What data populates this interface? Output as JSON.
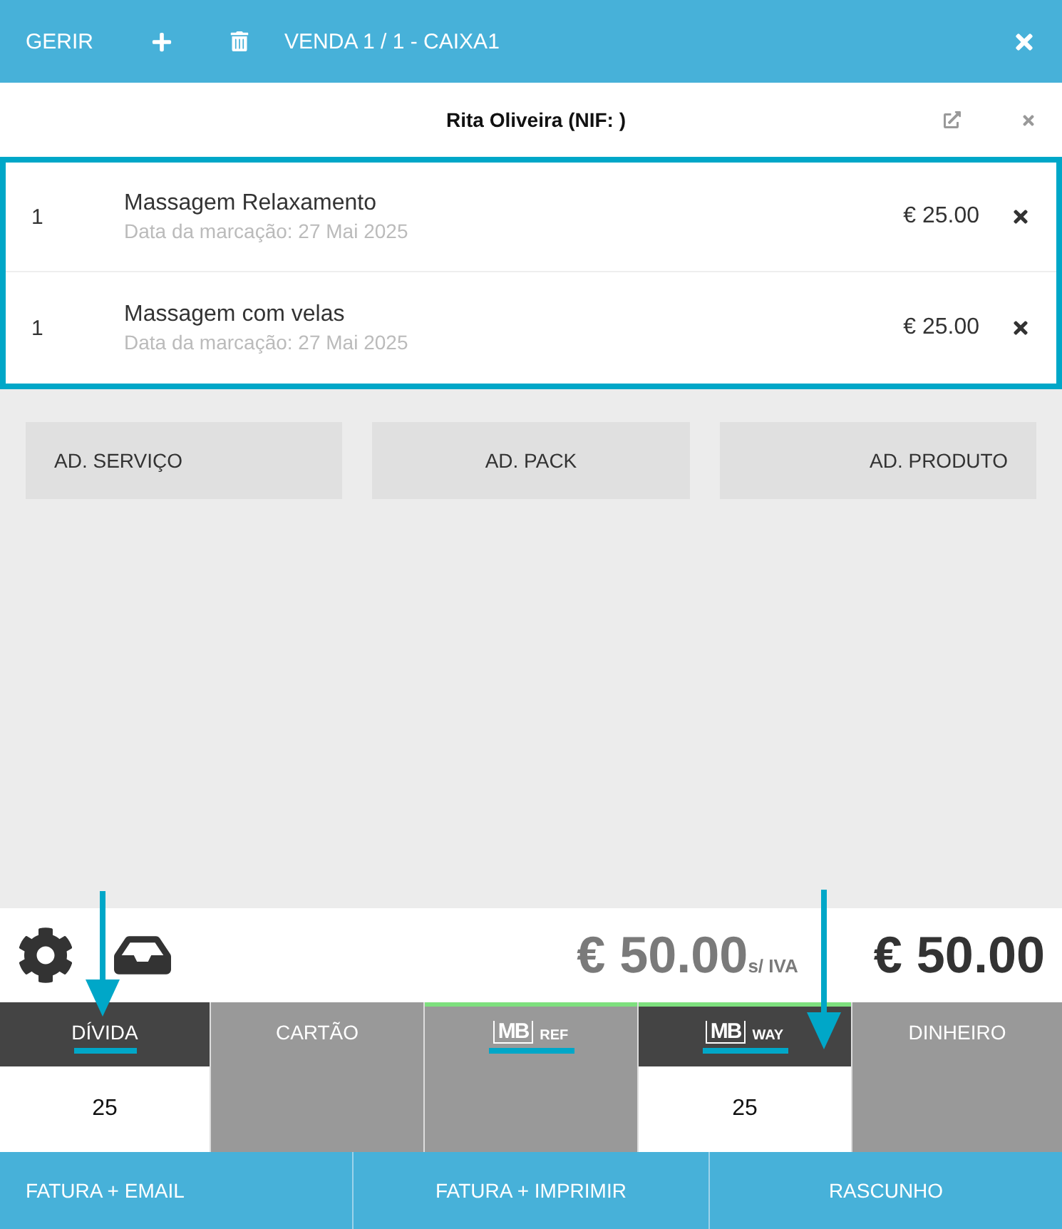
{
  "header": {
    "manage": "GERIR",
    "title": "VENDA 1 / 1 - CAIXA1"
  },
  "client": {
    "name": "Rita Oliveira (NIF: )"
  },
  "items": [
    {
      "qty": "1",
      "name": "Massagem Relaxamento",
      "date": "Data da marcação: 27 Mai 2025",
      "price": "€ 25.00"
    },
    {
      "qty": "1",
      "name": "Massagem com velas",
      "date": "Data da marcação: 27 Mai 2025",
      "price": "€ 25.00"
    }
  ],
  "add_buttons": [
    "AD. SERVIÇO",
    "AD. PACK",
    "AD. PRODUTO"
  ],
  "totals": {
    "net": "€ 50.00",
    "net_label": "s/ IVA",
    "total": "€ 50.00"
  },
  "payments": [
    {
      "kind": "text",
      "label": "DÍVIDA",
      "selected": true,
      "underlined": true,
      "accent": false,
      "value": "25"
    },
    {
      "kind": "text",
      "label": "CARTÃO",
      "selected": false,
      "underlined": false,
      "accent": false
    },
    {
      "kind": "mb",
      "logo": "MB",
      "label": "REF",
      "selected": false,
      "underlined": true,
      "accent": true
    },
    {
      "kind": "mb",
      "logo": "MB",
      "label": "WAY",
      "selected": true,
      "underlined": true,
      "accent": true,
      "value": "25"
    },
    {
      "kind": "text",
      "label": "DINHEIRO",
      "selected": false,
      "underlined": false,
      "accent": false
    }
  ],
  "footer": [
    "FATURA + EMAIL",
    "FATURA + IMPRIMIR",
    "RASCUNHO"
  ]
}
